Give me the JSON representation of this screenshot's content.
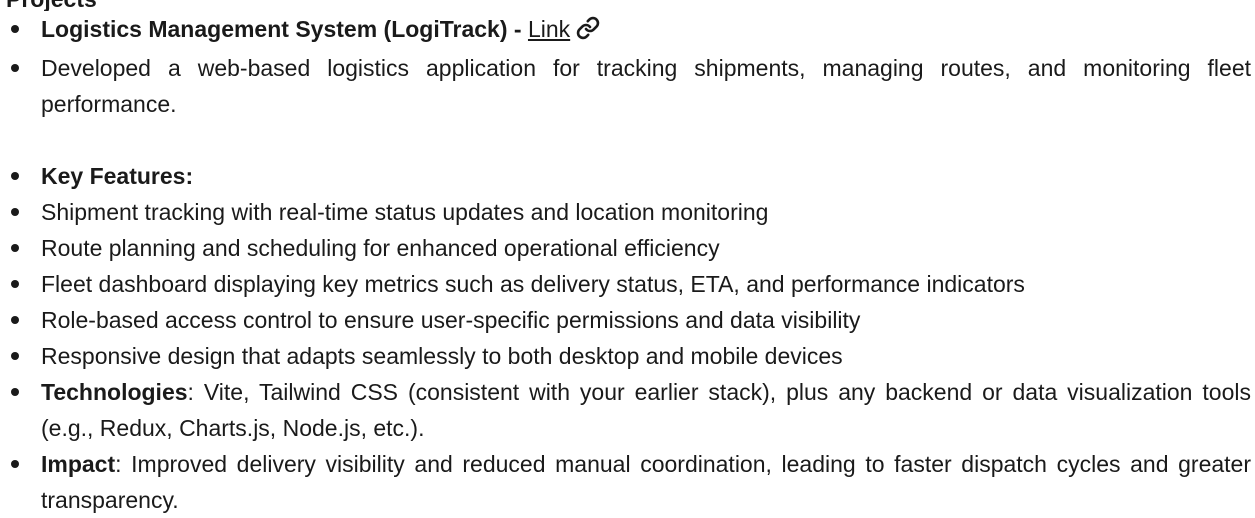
{
  "section_heading_partial": "Projects",
  "project": {
    "title": "Logistics Management System (LogiTrack)",
    "separator": " - ",
    "link_label": "Link",
    "link_icon": "link-icon",
    "description": "Developed a web-based logistics application for tracking shipments, managing routes, and monitoring fleet performance."
  },
  "features": {
    "heading": "Key Features:",
    "items": [
      "Shipment tracking with real-time status updates and location monitoring",
      "Route planning and scheduling for enhanced operational efficiency",
      "Fleet dashboard displaying key metrics such as delivery status, ETA, and performance indicators",
      "Role-based access control to ensure user-specific permissions and data visibility",
      "Responsive design that adapts seamlessly to both desktop and mobile devices"
    ]
  },
  "technologies": {
    "label": "Technologies",
    "text": ": Vite, Tailwind CSS (consistent with your earlier stack), plus any backend or data visualization tools (e.g., Redux, Charts.js, Node.js, etc.)."
  },
  "impact": {
    "label": "Impact",
    "text": ": Improved delivery visibility and reduced manual coordination, leading to faster dispatch cycles and greater transparency."
  }
}
